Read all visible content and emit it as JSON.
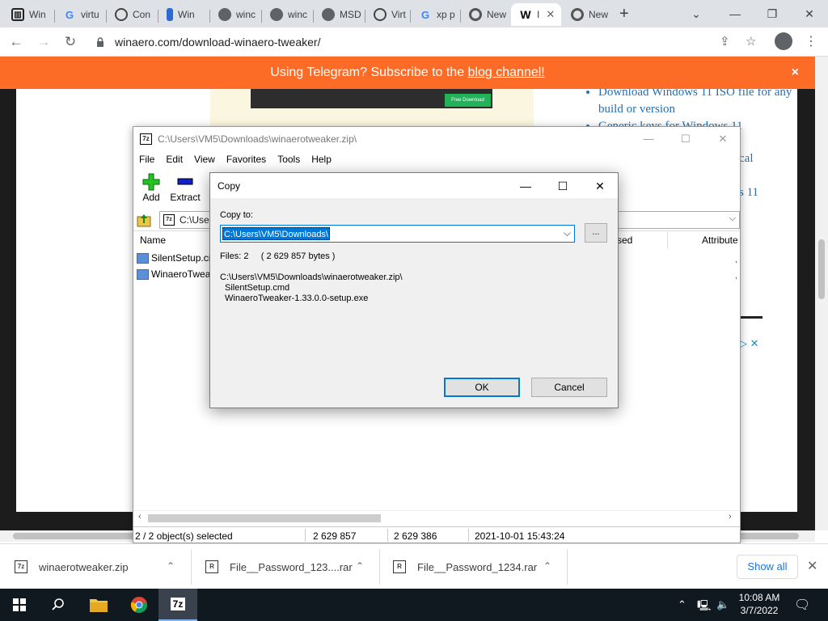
{
  "browser": {
    "tabs": [
      {
        "label": "Win",
        "icon": "winaero-icon"
      },
      {
        "label": "virtu",
        "icon": "google-icon"
      },
      {
        "label": "Con",
        "icon": "vmware-icon"
      },
      {
        "label": "Win",
        "icon": "vbox-icon"
      },
      {
        "label": "winc",
        "icon": "globe-icon"
      },
      {
        "label": "winc",
        "icon": "globe-icon"
      },
      {
        "label": "MSD",
        "icon": "globe-icon"
      },
      {
        "label": "Virt",
        "icon": "vmware-icon"
      },
      {
        "label": "xp p",
        "icon": "google-icon"
      },
      {
        "label": "New",
        "icon": "chrome-icon"
      },
      {
        "label": "I",
        "icon": "winaero-w-icon"
      },
      {
        "label": "New",
        "icon": "chrome-icon"
      }
    ],
    "active_tab_index": 10,
    "url": "winaero.com/download-winaero-tweaker/"
  },
  "page": {
    "banner_prefix": "Using Telegram? Subscribe to the ",
    "banner_link": "blog channel!",
    "banner_close": "×",
    "hero_button": "Free Download",
    "sidebar_links": [
      "Download Windows 11 ISO file for any build or version",
      "Generic keys for Windows 11",
      "cal",
      "s 11"
    ]
  },
  "zip_window": {
    "title": "C:\\Users\\VM5\\Downloads\\winaerotweaker.zip\\",
    "menu": [
      "File",
      "Edit",
      "View",
      "Favorites",
      "Tools",
      "Help"
    ],
    "tools": [
      {
        "label": "Add"
      },
      {
        "label": "Extract"
      }
    ],
    "address": "C:\\User",
    "columns": [
      "Name",
      "sed",
      "Attribute"
    ],
    "files": [
      "SilentSetup.cmd",
      "WinaeroTwea"
    ],
    "status": {
      "selected": "2 / 2 object(s) selected",
      "size": "2 629 857",
      "packed": "2 629 386",
      "modified": "2021-10-01 15:43:24"
    }
  },
  "copy_dialog": {
    "title": "Copy",
    "copy_to_label": "Copy to:",
    "destination": "C:\\Users\\VM5\\Downloads\\",
    "browse_label": "...",
    "files_summary": "Files: 2     ( 2 629 857 bytes )",
    "source_path": "C:\\Users\\VM5\\Downloads\\winaerotweaker.zip\\",
    "source_files": [
      "SilentSetup.cmd",
      "WinaeroTweaker-1.33.0.0-setup.exe"
    ],
    "ok_label": "OK",
    "cancel_label": "Cancel"
  },
  "downloads": {
    "items": [
      "winaerotweaker.zip",
      "File__Password_123....rar",
      "File__Password_1234.rar"
    ],
    "show_all": "Show all"
  },
  "taskbar": {
    "time": "10:08 AM",
    "date": "3/7/2022"
  },
  "colors": {
    "banner": "#fd6c27",
    "accent": "#0078d7",
    "link": "#2271b1",
    "taskbar": "#101820"
  }
}
